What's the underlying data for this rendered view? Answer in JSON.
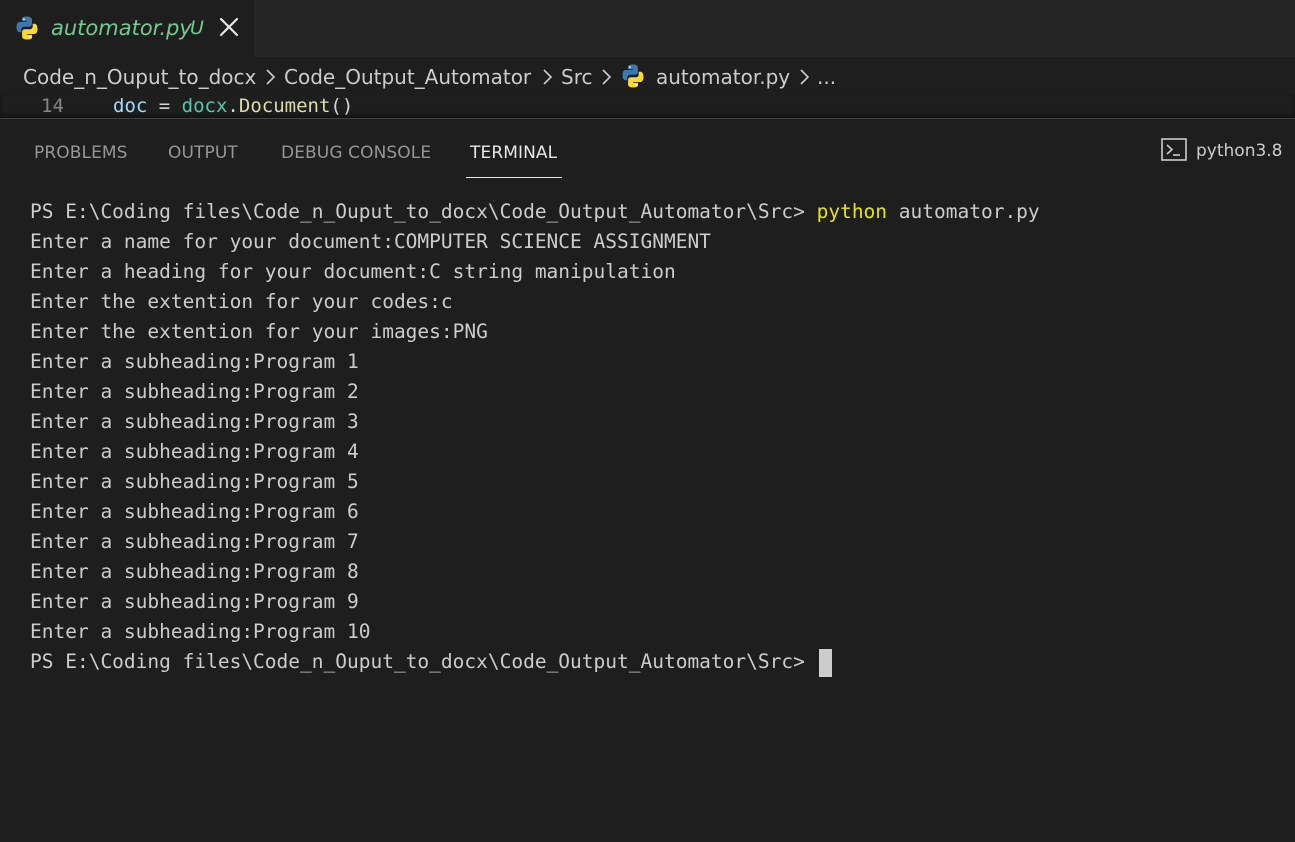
{
  "tab": {
    "name": "automator.py",
    "status": "U",
    "icon": "python-icon",
    "close_icon": "close-icon"
  },
  "breadcrumb": {
    "items": [
      "Code_n_Ouput_to_docx",
      "Code_Output_Automator",
      "Src",
      "automator.py",
      "..."
    ],
    "file_icon": "python-icon"
  },
  "editor": {
    "line_number": "14",
    "code": {
      "var": "doc",
      "op": " = ",
      "module": "docx",
      "dot": ".",
      "fn": "Document",
      "paren": "()"
    }
  },
  "panel": {
    "tabs": [
      "PROBLEMS",
      "OUTPUT",
      "DEBUG CONSOLE",
      "TERMINAL"
    ],
    "active_tab": "TERMINAL",
    "terminal_label": "python3.8",
    "terminal_icon": "terminal-icon"
  },
  "terminal": {
    "prompt": "PS E:\\Coding files\\Code_n_Ouput_to_docx\\Code_Output_Automator\\Src> ",
    "command_keyword": "python",
    "command_args": " automator.py",
    "lines": [
      "Enter a name for your document:COMPUTER SCIENCE ASSIGNMENT",
      "Enter a heading for your document:C string manipulation",
      "Enter the extention for your codes:c",
      "Enter the extention for your images:PNG",
      "Enter a subheading:Program 1",
      "Enter a subheading:Program 2",
      "Enter a subheading:Program 3",
      "Enter a subheading:Program 4",
      "Enter a subheading:Program 5",
      "Enter a subheading:Program 6",
      "Enter a subheading:Program 7",
      "Enter a subheading:Program 8",
      "Enter a subheading:Program 9",
      "Enter a subheading:Program 10"
    ],
    "final_prompt": "PS E:\\Coding files\\Code_n_Ouput_to_docx\\Code_Output_Automator\\Src>"
  },
  "colors": {
    "background": "#1e1e1e",
    "tabbar": "#252526",
    "git_untracked": "#73c991",
    "command": "#e5e510",
    "text": "#cccccc"
  }
}
